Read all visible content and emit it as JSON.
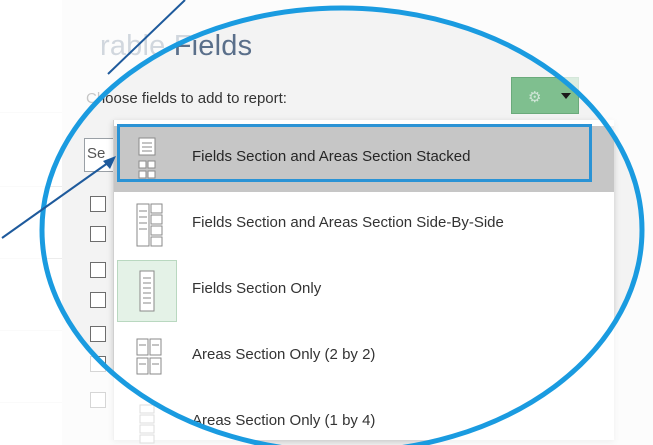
{
  "pane": {
    "title": "Pivot Table Fields",
    "title_visible": "rable Fields",
    "subtitle": "Choose fields to add to report:",
    "tools_button": {
      "icon": "gear-icon",
      "caret": "caret-down-icon",
      "color": "#7fbf8f"
    },
    "search": {
      "value": "Se"
    }
  },
  "menu": {
    "items": [
      {
        "label": "Fields Section and Areas Section Stacked",
        "icon": "layout-stacked-icon",
        "selected": true
      },
      {
        "label": "Fields Section and Areas Section Side-By-Side",
        "icon": "layout-side-by-side-icon",
        "selected": false
      },
      {
        "label": "Fields Section Only",
        "icon": "layout-fields-only-icon",
        "selected": false,
        "checked": true
      },
      {
        "label": "Areas Section Only (2 by 2)",
        "icon": "layout-areas-2x2-icon",
        "selected": false
      },
      {
        "label": "Areas Section Only (1 by 4)",
        "icon": "layout-areas-1x4-icon",
        "selected": false
      }
    ]
  },
  "colors": {
    "highlight_frame": "#2a93d5",
    "ellipse": "#1a9be0",
    "arrow": "#1e5a9c",
    "title_color": "#5a6f8a"
  }
}
